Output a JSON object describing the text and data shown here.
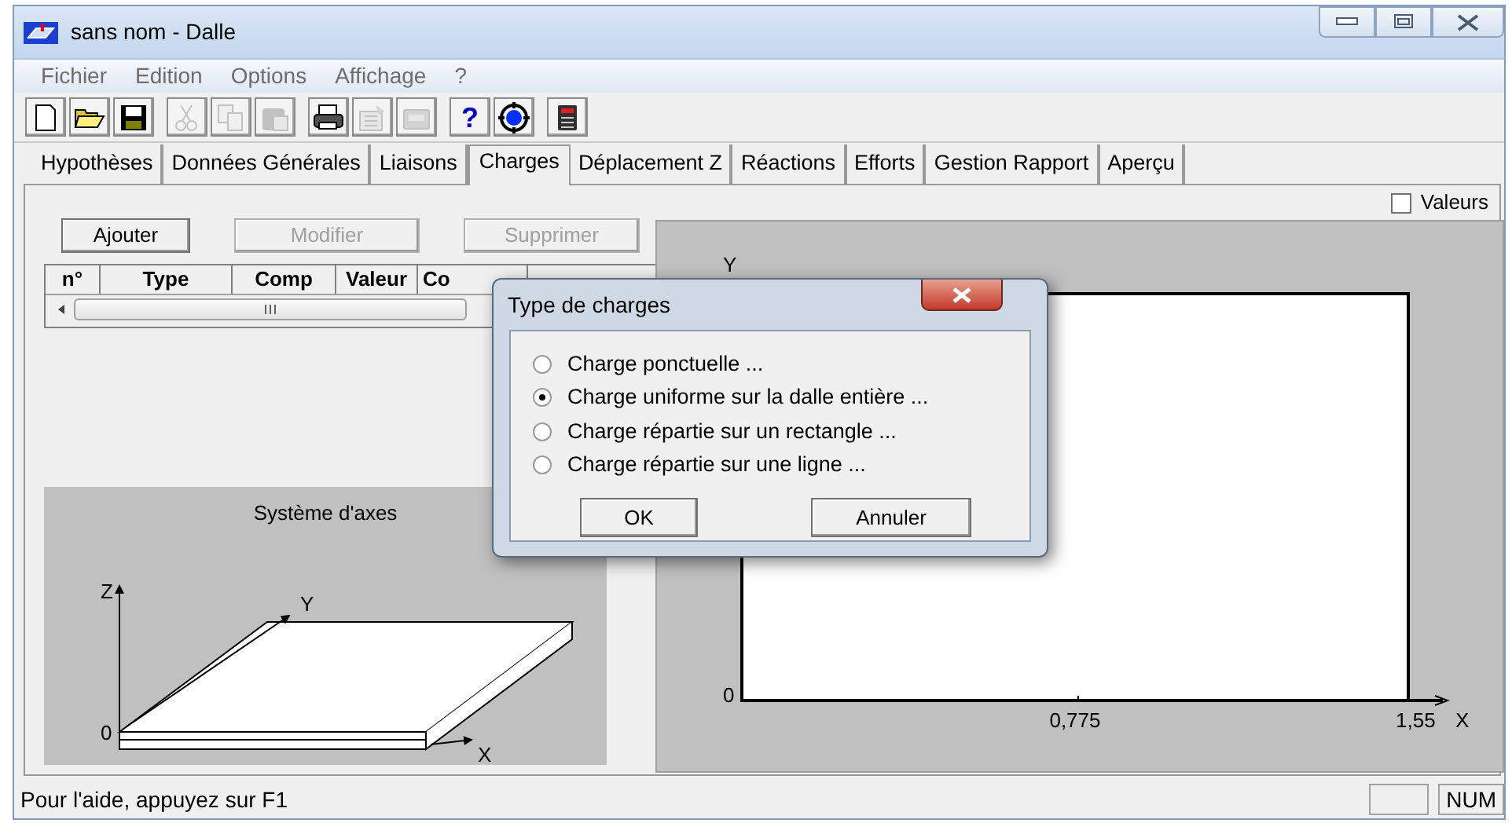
{
  "window": {
    "title": "sans nom - Dalle"
  },
  "menu": [
    "Fichier",
    "Edition",
    "Options",
    "Affichage",
    "?"
  ],
  "toolbar": [
    [
      {
        "kind": "new",
        "disabled": false
      },
      {
        "kind": "open",
        "disabled": false
      },
      {
        "kind": "save",
        "disabled": false
      }
    ],
    [
      {
        "kind": "cut",
        "disabled": true
      },
      {
        "kind": "copy",
        "disabled": true
      },
      {
        "kind": "paste",
        "disabled": true
      }
    ],
    [
      {
        "kind": "print",
        "disabled": false
      },
      {
        "kind": "properties",
        "disabled": true
      },
      {
        "kind": "tray",
        "disabled": true
      }
    ],
    [
      {
        "kind": "help",
        "label": "?",
        "disabled": false
      },
      {
        "kind": "target",
        "disabled": false
      }
    ],
    [
      {
        "kind": "calculator",
        "disabled": false
      }
    ]
  ],
  "tabs": [
    {
      "label": "Hypothèses",
      "selected": false
    },
    {
      "label": "Données Générales",
      "selected": false
    },
    {
      "label": "Liaisons",
      "selected": false
    },
    {
      "label": "Charges",
      "selected": true
    },
    {
      "label": "Déplacement Z",
      "selected": false
    },
    {
      "label": "Réactions",
      "selected": false
    },
    {
      "label": "Efforts",
      "selected": false
    },
    {
      "label": "Gestion Rapport",
      "selected": false
    },
    {
      "label": "Aperçu",
      "selected": false
    }
  ],
  "values_checkbox": {
    "label": "Valeurs",
    "checked": false
  },
  "buttons": [
    {
      "label": "Ajouter",
      "disabled": false
    },
    {
      "label": "Modifier",
      "disabled": true
    },
    {
      "label": "Supprimer",
      "disabled": true
    }
  ],
  "table": {
    "columns": [
      "n°",
      "Type",
      "Comp",
      "Valeur",
      "Co"
    ]
  },
  "axes_panel": {
    "title": "Système d'axes",
    "z_label": "Z",
    "y_label": "Y",
    "origin": "0",
    "x_label": "X"
  },
  "plot": {
    "y_label": "Y",
    "origin": "0",
    "x_ticks": [
      "0,775",
      "1,55"
    ],
    "x_label": "X"
  },
  "dialog": {
    "title": "Type de charges",
    "options": [
      {
        "label": "Charge ponctuelle ...",
        "selected": false
      },
      {
        "label": "Charge uniforme sur la dalle entière ...",
        "selected": true
      },
      {
        "label": "Charge répartie sur un rectangle ...",
        "selected": false
      },
      {
        "label": "Charge répartie sur une ligne ...",
        "selected": false
      }
    ],
    "buttons": [
      "OK",
      "Annuler"
    ]
  },
  "status_bar": {
    "text": "Pour l'aide, appuyez sur F1",
    "indicators": [
      "NUM"
    ]
  }
}
